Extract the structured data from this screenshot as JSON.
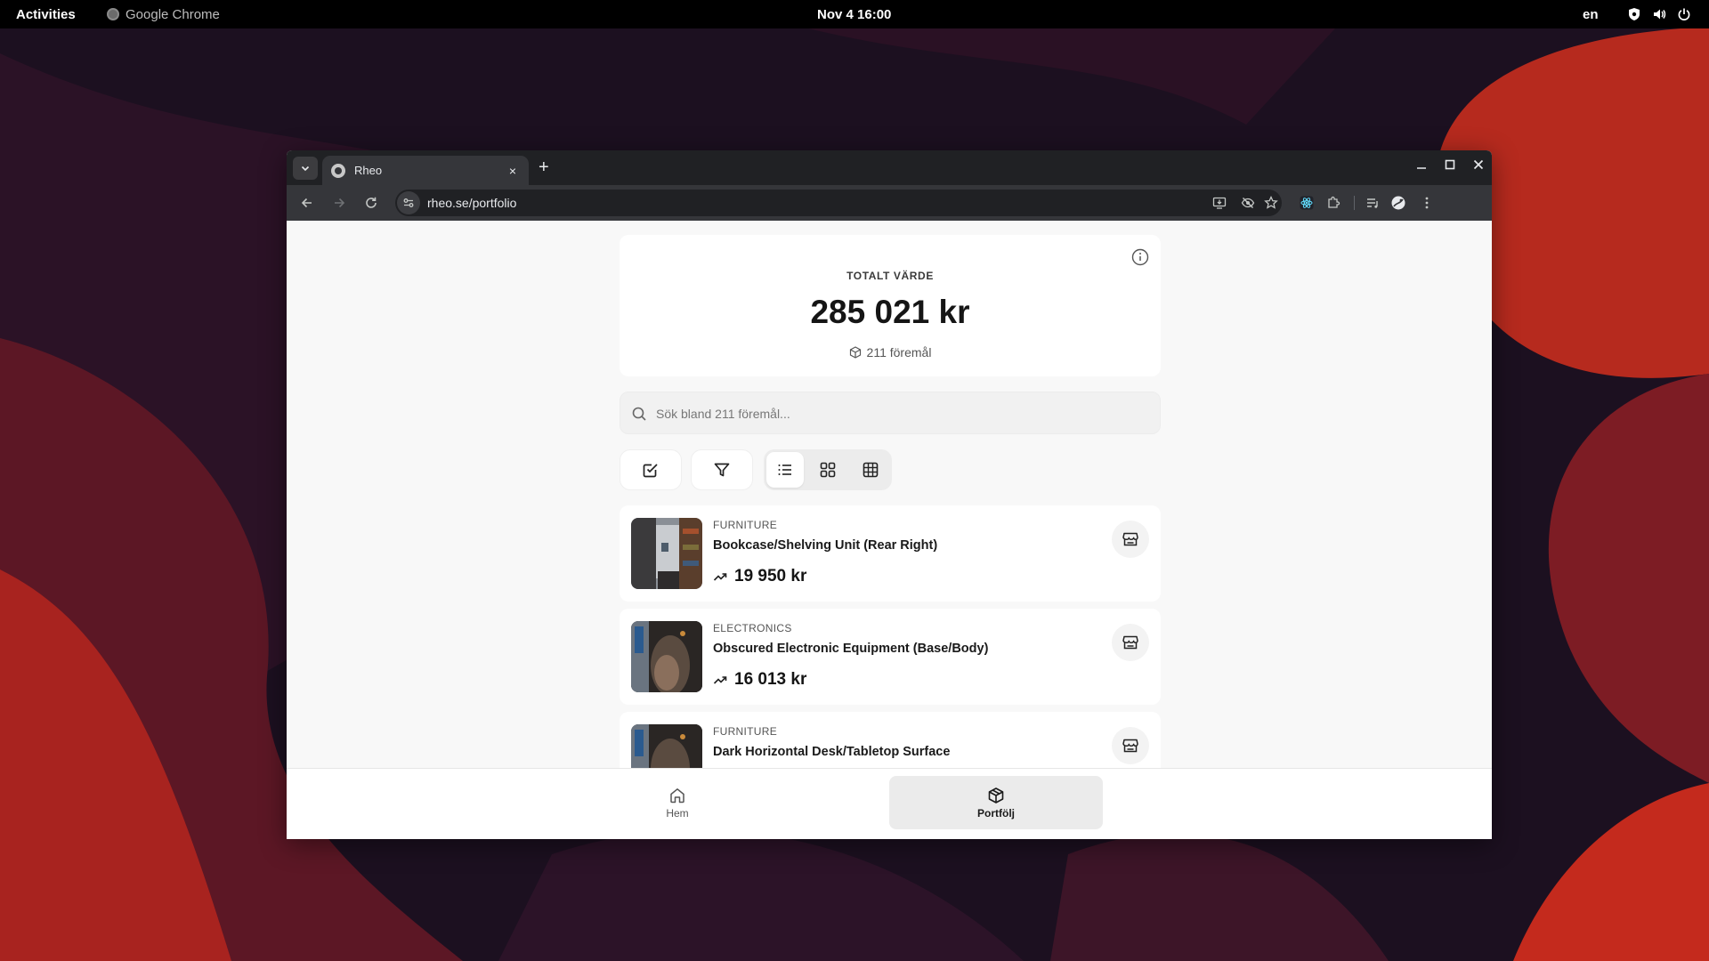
{
  "desktop": {
    "topbar": {
      "activities": "Activities",
      "active_app": "Google Chrome",
      "clock": "Nov 4  16:00",
      "language": "en",
      "tray_icons": [
        "shield-icon",
        "volume-icon",
        "power-icon"
      ]
    },
    "wallpaper_colors": [
      "#1e1020",
      "#3a1426",
      "#7a1d22",
      "#c42a1d"
    ]
  },
  "browser": {
    "tab": {
      "title": "Rheo",
      "close": "×"
    },
    "new_tab": "+",
    "url": "rheo.se/portfolio",
    "toolbar_icons": [
      "back-icon",
      "forward-icon",
      "reload-icon",
      "site-info-icon",
      "install-icon",
      "eye-off-icon",
      "bookmark-star-icon",
      "react-devtools-icon",
      "extensions-icon",
      "media-icon",
      "profile-icon",
      "menu-icon"
    ]
  },
  "summary": {
    "label": "TOTALT VÄRDE",
    "value": "285 021 kr",
    "item_count": "211 föremål"
  },
  "search": {
    "placeholder": "Sök bland 211 föremål..."
  },
  "controls": {
    "select_icon": "checkbox-icon",
    "filter_icon": "filter-icon",
    "views": [
      "list-view-icon",
      "grid-view-icon",
      "table-view-icon"
    ],
    "selected_view": "list"
  },
  "items": [
    {
      "category": "FURNITURE",
      "name": "Bookcase/Shelving Unit (Rear Right)",
      "value": "19 950 kr"
    },
    {
      "category": "ELECTRONICS",
      "name": "Obscured Electronic Equipment (Base/Body)",
      "value": "16 013 kr"
    },
    {
      "category": "FURNITURE",
      "name": "Dark Horizontal Desk/Tabletop Surface",
      "value": ""
    }
  ],
  "bottom_nav": {
    "home": "Hem",
    "portfolio": "Portfölj",
    "active": "portfolio"
  },
  "colors": {
    "page_bg": "#f8f8f8",
    "chrome_dark": "#202124",
    "chrome_toolbar": "#35363a",
    "text_primary": "#151515"
  }
}
